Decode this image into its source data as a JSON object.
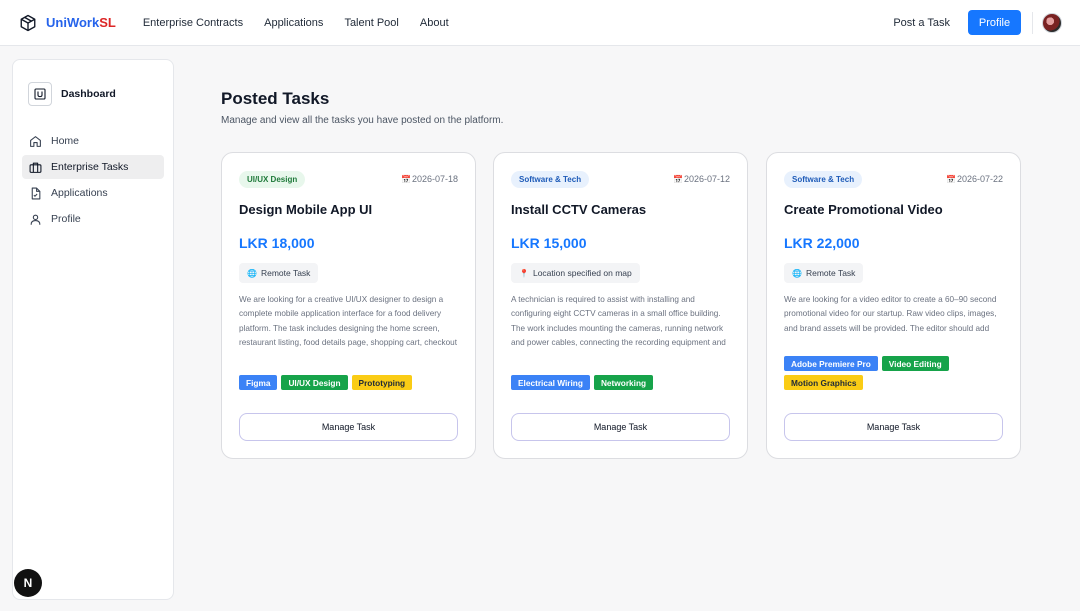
{
  "brand": {
    "name_part1": "UniWork",
    "name_part2": "SL",
    "icon": "cube-icon"
  },
  "nav": {
    "links": [
      "Enterprise Contracts",
      "Applications",
      "Talent Pool",
      "About"
    ],
    "post_task": "Post a Task",
    "profile": "Profile"
  },
  "sidebar": {
    "title": "Dashboard",
    "logo_letter": "U",
    "items": [
      {
        "label": "Home",
        "icon": "home-icon"
      },
      {
        "label": "Enterprise Tasks",
        "icon": "briefcase-icon",
        "active": true
      },
      {
        "label": "Applications",
        "icon": "file-icon"
      },
      {
        "label": "Profile",
        "icon": "user-icon"
      }
    ]
  },
  "next_badge": "N",
  "main": {
    "title": "Posted Tasks",
    "subtitle": "Manage and view all the tasks you have posted on the platform."
  },
  "tasks": [
    {
      "category": "UI/UX Design",
      "date": "2026-07-18",
      "title": "Design Mobile App UI",
      "price": "LKR 18,000",
      "location": "Remote Task",
      "description": "We are looking for a creative UI/UX designer to design a complete mobile application interface for a food delivery platform. The task includes designing the home screen, restaurant listing, food details page, shopping cart, checkout screen and user profile. The",
      "tags": [
        "Figma",
        "UI/UX Design",
        "Prototyping"
      ],
      "button": "Manage Task"
    },
    {
      "category": "Software & Tech",
      "date": "2026-07-12",
      "title": "Install CCTV Cameras",
      "price": "LKR 15,000",
      "location": "Location specified on map",
      "description": "A technician is required to assist with installing and configuring eight CCTV cameras in a small office building. The work includes mounting the cameras, running network and power cables, connecting the recording equipment and testing each camera",
      "tags": [
        "Electrical Wiring",
        "Networking"
      ],
      "button": "Manage Task"
    },
    {
      "category": "Software & Tech",
      "date": "2026-07-22",
      "title": "Create Promotional Video",
      "price": "LKR 22,000",
      "location": "Remote Task",
      "description": "We are looking for a video editor to create a 60–90 second promotional video for our startup. Raw video clips, images, and brand assets will be provided. The editor should add music and transitions",
      "tags": [
        "Adobe Premiere Pro",
        "Video Editing",
        "Motion Graphics"
      ],
      "button": "Manage Task"
    }
  ],
  "colors": {
    "primary": "#1677ff",
    "brand_red": "#dc2626"
  }
}
